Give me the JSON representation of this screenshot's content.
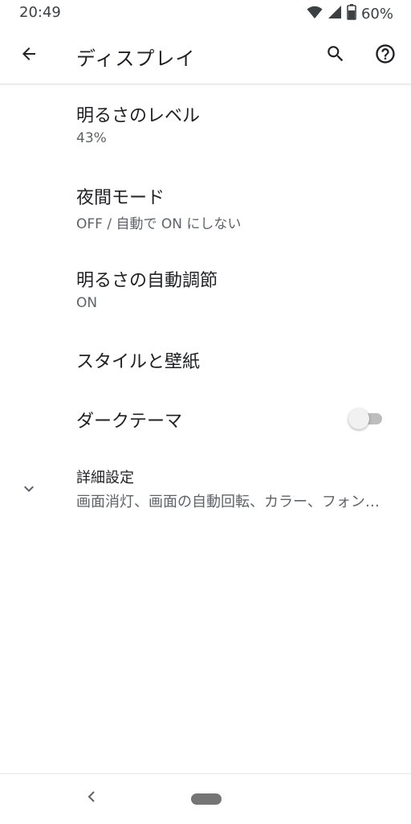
{
  "status_bar": {
    "time": "20:49",
    "battery_level": "60%",
    "icons": [
      "wifi-icon",
      "signal-icon",
      "battery-icon"
    ]
  },
  "app_bar": {
    "title": "ディスプレイ",
    "back_icon": "arrow-back-icon",
    "search_icon": "search-icon",
    "help_icon": "help-icon"
  },
  "settings": {
    "brightness": {
      "title": "明るさのレベル",
      "summary": "43%"
    },
    "night_mode": {
      "title": "夜間モード",
      "summary": "OFF / 自動で ON にしない"
    },
    "adaptive_brightness": {
      "title": "明るさの自動調節",
      "summary": "ON"
    },
    "styles_wallpapers": {
      "title": "スタイルと壁紙"
    },
    "dark_theme": {
      "title": "ダークテーマ",
      "enabled": false
    },
    "advanced": {
      "title": "詳細設定",
      "summary": "画面消灯、画面の自動回転、カラー、フォントサイズ",
      "expand_icon": "chevron-down-icon"
    }
  },
  "nav_bar": {
    "back_icon": "nav-back-icon",
    "home_icon": "home-pill-icon"
  },
  "colors": {
    "text_primary": "#202124",
    "text_secondary": "#5f6368",
    "toggle_off_track": "#bdbdbd",
    "toggle_off_thumb": "#f1f1f1"
  }
}
